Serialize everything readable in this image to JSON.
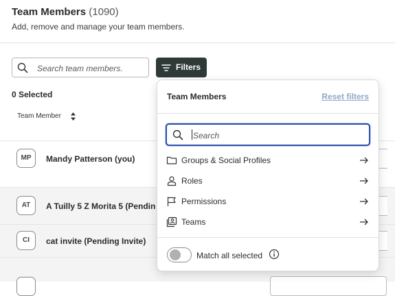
{
  "header": {
    "title": "Team Members",
    "count": "(1090)",
    "subtitle": "Add, remove and manage your team members."
  },
  "toolbar": {
    "search_placeholder": "Search team members.",
    "filters_label": "Filters"
  },
  "list": {
    "selected_text": "0 Selected",
    "column_header": "Team Member",
    "rows": [
      {
        "initials": "MP",
        "name": "Mandy Patterson (you)"
      },
      {
        "initials": "AT",
        "name": "A Tuilly 5 Z Morita 5 (Pendin"
      },
      {
        "initials": "CI",
        "name": "cat invite (Pending Invite)"
      },
      {
        "initials": "",
        "name": ""
      }
    ]
  },
  "filter_panel": {
    "title": "Team Members",
    "reset_label": "Reset filters",
    "search_placeholder": "Search",
    "options": [
      {
        "label": "Groups & Social Profiles",
        "icon": "folder-icon"
      },
      {
        "label": "Roles",
        "icon": "person-icon"
      },
      {
        "label": "Permissions",
        "icon": "flag-icon"
      },
      {
        "label": "Teams",
        "icon": "team-icon"
      }
    ],
    "match_all_label": "Match all selected",
    "match_all_enabled": false
  },
  "colors": {
    "primary_button": "#2f3a38",
    "focus_border": "#2b4fa8",
    "link": "#8fa7c9",
    "row_alt_bg": "#f4f4f4"
  }
}
